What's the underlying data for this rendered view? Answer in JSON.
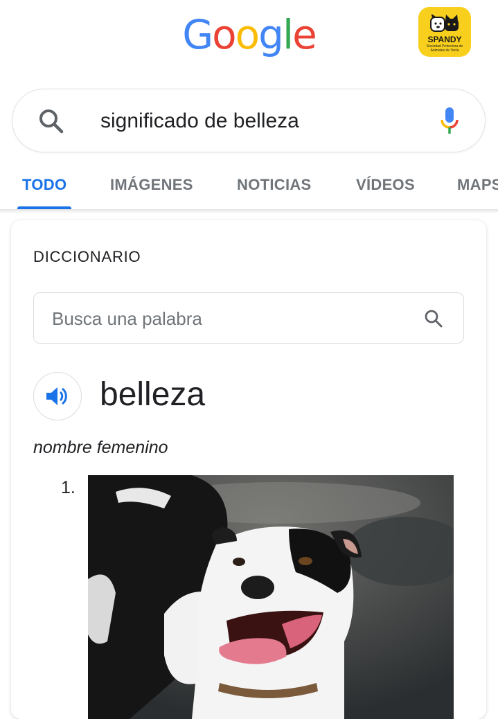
{
  "header": {
    "logo_text": "Google",
    "logo_letters": [
      {
        "ch": "G",
        "color": "#4285f4"
      },
      {
        "ch": "o",
        "color": "#ea4335"
      },
      {
        "ch": "o",
        "color": "#fbbc05"
      },
      {
        "ch": "g",
        "color": "#4285f4"
      },
      {
        "ch": "l",
        "color": "#34a853"
      },
      {
        "ch": "e",
        "color": "#ea4335"
      }
    ],
    "badge_title": "SPANDY",
    "badge_subtitle": "Sociedad Protectora de Animales de Yecla"
  },
  "search": {
    "query": "significado de belleza",
    "icon": "search-icon",
    "mic_icon": "mic-icon"
  },
  "tabs": [
    {
      "label": "TODO",
      "active": true
    },
    {
      "label": "IMÁGENES",
      "active": false
    },
    {
      "label": "NOTICIAS",
      "active": false
    },
    {
      "label": "VÍDEOS",
      "active": false
    },
    {
      "label": "MAPS",
      "active": false
    }
  ],
  "dictionary": {
    "section_title": "DICCIONARIO",
    "search_placeholder": "Busca una palabra",
    "word": "belleza",
    "part_of_speech": "nombre femenino",
    "definition_number": "1.",
    "speaker_icon": "speaker-icon",
    "image_description": "dog-photo"
  },
  "colors": {
    "accent": "#1a73e8",
    "badge_bg": "#f7cf1c"
  }
}
